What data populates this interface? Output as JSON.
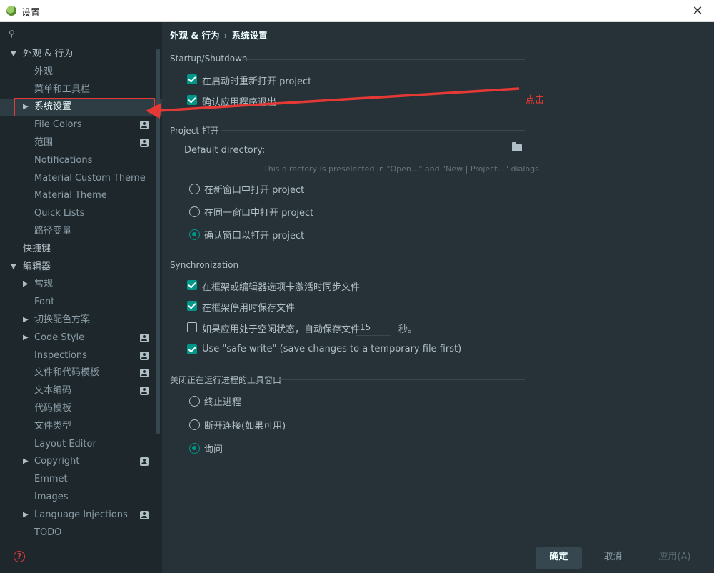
{
  "window": {
    "title": "设置",
    "close_glyph": "✕",
    "icon": "app-logo-icon"
  },
  "sidebar": {
    "search_icon": "search-icon",
    "items": [
      {
        "label": "外观 & 行为",
        "arrow": "▼",
        "level": 0,
        "bold": true
      },
      {
        "label": "外观",
        "level": 1
      },
      {
        "label": "菜单和工具栏",
        "level": 1
      },
      {
        "label": "系统设置",
        "arrow": "▶",
        "level": 1,
        "selected": true
      },
      {
        "label": "File Colors",
        "level": 1,
        "badge": true
      },
      {
        "label": "范围",
        "level": 1,
        "badge": true
      },
      {
        "label": "Notifications",
        "level": 1
      },
      {
        "label": "Material Custom Theme",
        "level": 1
      },
      {
        "label": "Material Theme",
        "level": 1
      },
      {
        "label": "Quick Lists",
        "level": 1
      },
      {
        "label": "路径变量",
        "level": 1
      },
      {
        "label": "快捷键",
        "level": 0,
        "bold": true
      },
      {
        "label": "编辑器",
        "arrow": "▼",
        "level": 0,
        "bold": true
      },
      {
        "label": "常规",
        "arrow": "▶",
        "level": 1
      },
      {
        "label": "Font",
        "level": 1
      },
      {
        "label": "切换配色方案",
        "arrow": "▶",
        "level": 1
      },
      {
        "label": "Code Style",
        "arrow": "▶",
        "level": 1,
        "badge": true
      },
      {
        "label": "Inspections",
        "level": 1,
        "badge": true
      },
      {
        "label": "文件和代码模板",
        "level": 1,
        "badge": true
      },
      {
        "label": "文本编码",
        "level": 1,
        "badge": true
      },
      {
        "label": "代码模板",
        "level": 1
      },
      {
        "label": "文件类型",
        "level": 1
      },
      {
        "label": "Layout Editor",
        "level": 1
      },
      {
        "label": "Copyright",
        "arrow": "▶",
        "level": 1,
        "badge": true
      },
      {
        "label": "Emmet",
        "level": 1
      },
      {
        "label": "Images",
        "level": 1
      },
      {
        "label": "Language Injections",
        "arrow": "▶",
        "level": 1,
        "badge": true
      },
      {
        "label": "TODO",
        "level": 1
      }
    ]
  },
  "breadcrumb": {
    "parent": "外观 & 行为",
    "separator": "›",
    "current": "系统设置"
  },
  "startup": {
    "title": "Startup/Shutdown",
    "reopen_label": "在启动时重新打开 project",
    "reopen_checked": true,
    "confirm_exit_label": "确认应用程序退出",
    "confirm_exit_checked": true
  },
  "project_open": {
    "title": "Project 打开",
    "default_dir_label": "Default directory:",
    "default_dir_value": "",
    "hint": "This directory is preselected in \"Open...\" and \"New | Project...\" dialogs.",
    "options": [
      {
        "label": "在新窗口中打开 project",
        "checked": false
      },
      {
        "label": "在同一窗口中打开 project",
        "checked": false
      },
      {
        "label": "确认窗口以打开 project",
        "checked": true
      }
    ]
  },
  "sync": {
    "title": "Synchronization",
    "sync_on_activate_label": "在框架或编辑器选项卡激活时同步文件",
    "sync_on_activate_checked": true,
    "save_on_deactivate_label": "在框架停用时保存文件",
    "save_on_deactivate_checked": true,
    "idle_save_label": "如果应用处于空闲状态，自动保存文件",
    "idle_save_checked": false,
    "idle_seconds": "15",
    "idle_unit": "秒。",
    "safe_write_label": "Use \"safe write\" (save changes to a temporary file first)",
    "safe_write_checked": true
  },
  "close_tools": {
    "title": "关闭正在运行进程的工具窗口",
    "options": [
      {
        "label": "终止进程",
        "checked": false
      },
      {
        "label": "断开连接(如果可用)",
        "checked": false
      },
      {
        "label": "询问",
        "checked": true
      }
    ]
  },
  "footer": {
    "help_icon": "help-icon",
    "ok_label": "确定",
    "cancel_label": "取消",
    "apply_label": "应用(A)"
  },
  "annotation": {
    "label": "点击",
    "color": "#e53935"
  },
  "colors": {
    "accent": "#009688",
    "sidebar_bg": "#1E272C",
    "main_bg": "#263238",
    "selected_bg": "#2E3C43"
  }
}
